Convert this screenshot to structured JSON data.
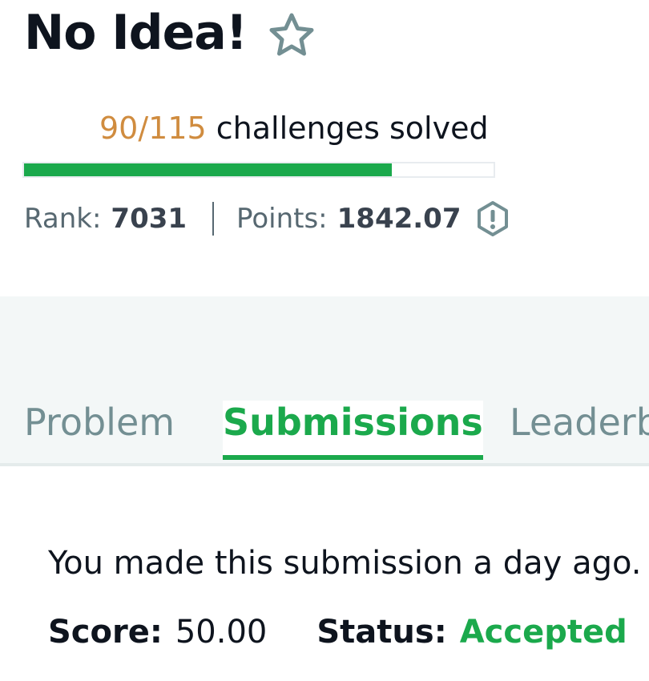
{
  "challenge": {
    "title": "No Idea!"
  },
  "progress": {
    "solved": "90/115",
    "label": "challenges solved",
    "fraction": 0.7826
  },
  "stats": {
    "rank_label": "Rank:",
    "rank_value": "7031",
    "points_label": "Points:",
    "points_value": "1842.07"
  },
  "tabs": {
    "problem": "Problem",
    "submissions": "Submissions",
    "leaderboard": "Leaderb"
  },
  "submission": {
    "note": "You made this submission a day ago.",
    "score_label": "Score:",
    "score_value": "50.00",
    "status_label": "Status:",
    "status_value": "Accepted"
  },
  "colors": {
    "accent_green": "#1ba94c",
    "progress_count": "#d08c3f",
    "tab_inactive": "#738f93"
  },
  "icons": {
    "favorite": "star-outline-icon",
    "points_info": "exclamation-circle-icon"
  }
}
